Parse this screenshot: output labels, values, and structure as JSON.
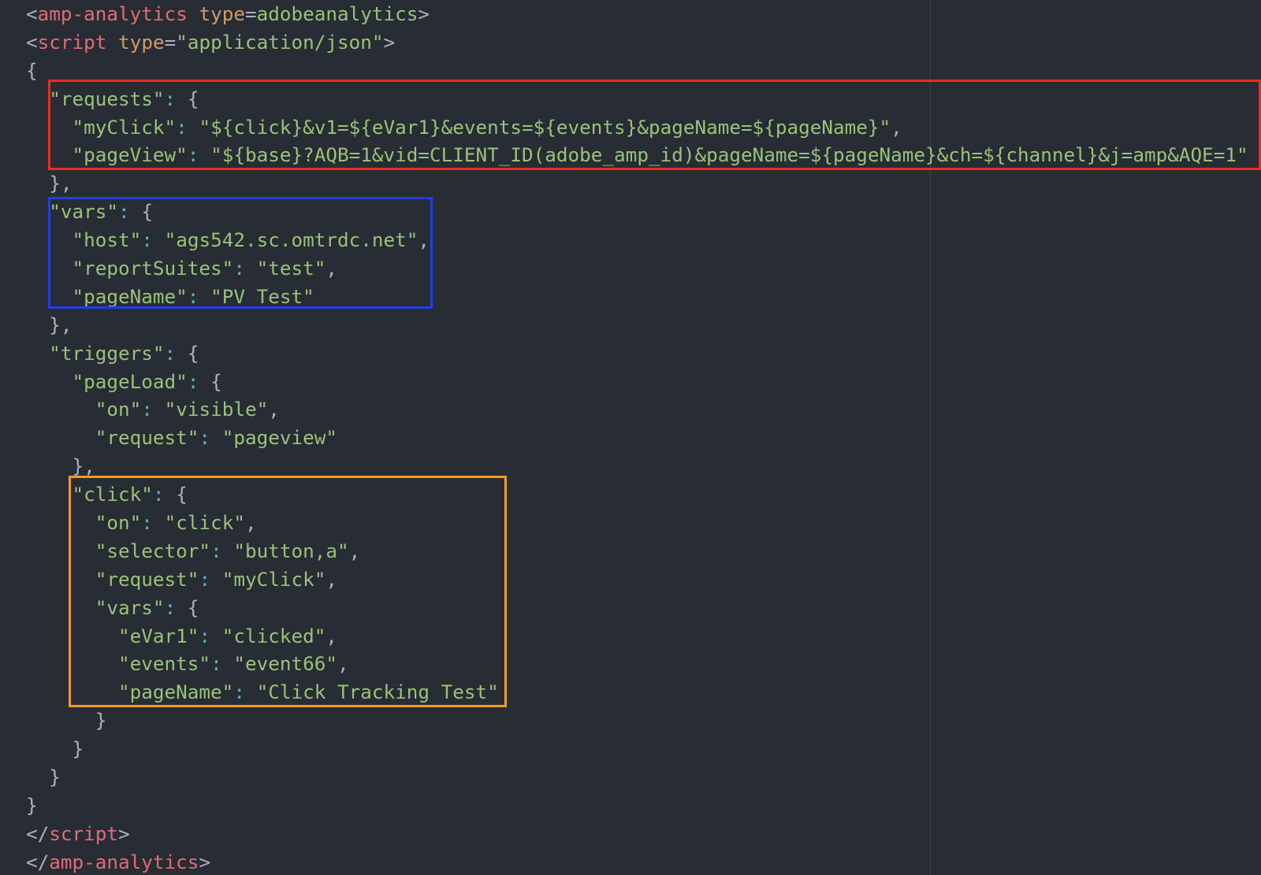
{
  "colors": {
    "background": "#282c34",
    "tag": "#e06c75",
    "attribute": "#d19a66",
    "string": "#98c379",
    "colon": "#56b6c2",
    "punctuation": "#abb2bf",
    "box_requests": "#ee2a24",
    "box_vars": "#1f3fe6",
    "box_click": "#f59a23"
  },
  "lines": [
    [
      {
        "t": "<",
        "c": "punct"
      },
      {
        "t": "amp-analytics",
        "c": "tag"
      },
      {
        "t": " ",
        "c": "plain"
      },
      {
        "t": "type",
        "c": "attr"
      },
      {
        "t": "=",
        "c": "punct"
      },
      {
        "t": "adobeanalytics",
        "c": "str"
      },
      {
        "t": ">",
        "c": "punct"
      }
    ],
    [
      {
        "t": "<",
        "c": "punct"
      },
      {
        "t": "script",
        "c": "tag"
      },
      {
        "t": " ",
        "c": "plain"
      },
      {
        "t": "type",
        "c": "attr"
      },
      {
        "t": "=",
        "c": "punct"
      },
      {
        "t": "\"application/json\"",
        "c": "str"
      },
      {
        "t": ">",
        "c": "punct"
      }
    ],
    [
      {
        "t": "{",
        "c": "punct"
      }
    ],
    [
      {
        "t": "  ",
        "c": "plain"
      },
      {
        "t": "\"requests\"",
        "c": "str"
      },
      {
        "t": ":",
        "c": "colon"
      },
      {
        "t": " {",
        "c": "punct"
      }
    ],
    [
      {
        "t": "    ",
        "c": "plain"
      },
      {
        "t": "\"myClick\"",
        "c": "str"
      },
      {
        "t": ":",
        "c": "colon"
      },
      {
        "t": " ",
        "c": "plain"
      },
      {
        "t": "\"${click}&v1=${eVar1}&events=${events}&pageName=${pageName}\"",
        "c": "str"
      },
      {
        "t": ",",
        "c": "punct"
      }
    ],
    [
      {
        "t": "    ",
        "c": "plain"
      },
      {
        "t": "\"pageView\"",
        "c": "str"
      },
      {
        "t": ":",
        "c": "colon"
      },
      {
        "t": " ",
        "c": "plain"
      },
      {
        "t": "\"${base}?AQB=1&vid=CLIENT_ID(adobe_amp_id)&pageName=${pageName}&ch=${channel}&j=amp&AQE=1\"",
        "c": "str"
      }
    ],
    [
      {
        "t": "  },",
        "c": "punct"
      }
    ],
    [
      {
        "t": "  ",
        "c": "plain"
      },
      {
        "t": "\"vars\"",
        "c": "str"
      },
      {
        "t": ":",
        "c": "colon"
      },
      {
        "t": " {",
        "c": "punct"
      }
    ],
    [
      {
        "t": "    ",
        "c": "plain"
      },
      {
        "t": "\"host\"",
        "c": "str"
      },
      {
        "t": ":",
        "c": "colon"
      },
      {
        "t": " ",
        "c": "plain"
      },
      {
        "t": "\"ags542.sc.omtrdc.net\"",
        "c": "str"
      },
      {
        "t": ",",
        "c": "punct"
      }
    ],
    [
      {
        "t": "    ",
        "c": "plain"
      },
      {
        "t": "\"reportSuites\"",
        "c": "str"
      },
      {
        "t": ":",
        "c": "colon"
      },
      {
        "t": " ",
        "c": "plain"
      },
      {
        "t": "\"test\"",
        "c": "str"
      },
      {
        "t": ",",
        "c": "punct"
      }
    ],
    [
      {
        "t": "    ",
        "c": "plain"
      },
      {
        "t": "\"pageName\"",
        "c": "str"
      },
      {
        "t": ":",
        "c": "colon"
      },
      {
        "t": " ",
        "c": "plain"
      },
      {
        "t": "\"PV Test\"",
        "c": "str"
      }
    ],
    [
      {
        "t": "  },",
        "c": "punct"
      }
    ],
    [
      {
        "t": "  ",
        "c": "plain"
      },
      {
        "t": "\"triggers\"",
        "c": "str"
      },
      {
        "t": ":",
        "c": "colon"
      },
      {
        "t": " {",
        "c": "punct"
      }
    ],
    [
      {
        "t": "    ",
        "c": "plain"
      },
      {
        "t": "\"pageLoad\"",
        "c": "str"
      },
      {
        "t": ":",
        "c": "colon"
      },
      {
        "t": " {",
        "c": "punct"
      }
    ],
    [
      {
        "t": "      ",
        "c": "plain"
      },
      {
        "t": "\"on\"",
        "c": "str"
      },
      {
        "t": ":",
        "c": "colon"
      },
      {
        "t": " ",
        "c": "plain"
      },
      {
        "t": "\"visible\"",
        "c": "str"
      },
      {
        "t": ",",
        "c": "punct"
      }
    ],
    [
      {
        "t": "      ",
        "c": "plain"
      },
      {
        "t": "\"request\"",
        "c": "str"
      },
      {
        "t": ":",
        "c": "colon"
      },
      {
        "t": " ",
        "c": "plain"
      },
      {
        "t": "\"pageview\"",
        "c": "str"
      }
    ],
    [
      {
        "t": "    },",
        "c": "punct"
      }
    ],
    [
      {
        "t": "    ",
        "c": "plain"
      },
      {
        "t": "\"click\"",
        "c": "str"
      },
      {
        "t": ":",
        "c": "colon"
      },
      {
        "t": " {",
        "c": "punct"
      }
    ],
    [
      {
        "t": "      ",
        "c": "plain"
      },
      {
        "t": "\"on\"",
        "c": "str"
      },
      {
        "t": ":",
        "c": "colon"
      },
      {
        "t": " ",
        "c": "plain"
      },
      {
        "t": "\"click\"",
        "c": "str"
      },
      {
        "t": ",",
        "c": "punct"
      }
    ],
    [
      {
        "t": "      ",
        "c": "plain"
      },
      {
        "t": "\"selector\"",
        "c": "str"
      },
      {
        "t": ":",
        "c": "colon"
      },
      {
        "t": " ",
        "c": "plain"
      },
      {
        "t": "\"button,a\"",
        "c": "str"
      },
      {
        "t": ",",
        "c": "punct"
      }
    ],
    [
      {
        "t": "      ",
        "c": "plain"
      },
      {
        "t": "\"request\"",
        "c": "str"
      },
      {
        "t": ":",
        "c": "colon"
      },
      {
        "t": " ",
        "c": "plain"
      },
      {
        "t": "\"myClick\"",
        "c": "str"
      },
      {
        "t": ",",
        "c": "punct"
      }
    ],
    [
      {
        "t": "      ",
        "c": "plain"
      },
      {
        "t": "\"vars\"",
        "c": "str"
      },
      {
        "t": ":",
        "c": "colon"
      },
      {
        "t": " {",
        "c": "punct"
      }
    ],
    [
      {
        "t": "        ",
        "c": "plain"
      },
      {
        "t": "\"eVar1\"",
        "c": "str"
      },
      {
        "t": ":",
        "c": "colon"
      },
      {
        "t": " ",
        "c": "plain"
      },
      {
        "t": "\"clicked\"",
        "c": "str"
      },
      {
        "t": ",",
        "c": "punct"
      }
    ],
    [
      {
        "t": "        ",
        "c": "plain"
      },
      {
        "t": "\"events\"",
        "c": "str"
      },
      {
        "t": ":",
        "c": "colon"
      },
      {
        "t": " ",
        "c": "plain"
      },
      {
        "t": "\"event66\"",
        "c": "str"
      },
      {
        "t": ",",
        "c": "punct"
      }
    ],
    [
      {
        "t": "        ",
        "c": "plain"
      },
      {
        "t": "\"pageName\"",
        "c": "str"
      },
      {
        "t": ":",
        "c": "colon"
      },
      {
        "t": " ",
        "c": "plain"
      },
      {
        "t": "\"Click Tracking Test\"",
        "c": "str"
      }
    ],
    [
      {
        "t": "      }",
        "c": "punct"
      }
    ],
    [
      {
        "t": "    }",
        "c": "punct"
      }
    ],
    [
      {
        "t": "  }",
        "c": "punct"
      }
    ],
    [
      {
        "t": "}",
        "c": "punct"
      }
    ],
    [
      {
        "t": "</",
        "c": "punct"
      },
      {
        "t": "script",
        "c": "tag"
      },
      {
        "t": ">",
        "c": "punct"
      }
    ],
    [
      {
        "t": "</",
        "c": "punct"
      },
      {
        "t": "amp-analytics",
        "c": "tag"
      },
      {
        "t": ">",
        "c": "punct"
      }
    ]
  ]
}
